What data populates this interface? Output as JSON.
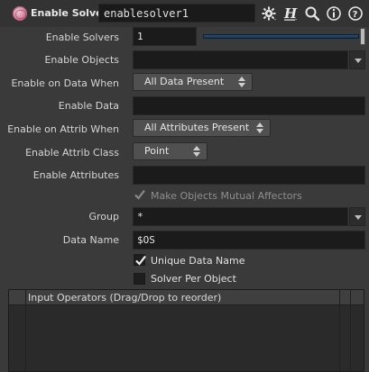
{
  "header": {
    "node_type": "Enable Solver",
    "node_name": "enablesolver1",
    "icons": [
      "brain-icon",
      "gear-icon",
      "help-h-icon",
      "search-icon",
      "info-icon",
      "help-icon"
    ]
  },
  "parameters": {
    "enable_solvers": {
      "label": "Enable Solvers",
      "value": "1",
      "slider_fraction": 1.0
    },
    "enable_objects": {
      "label": "Enable Objects",
      "value": ""
    },
    "enable_on_data_when": {
      "label": "Enable on Data When",
      "selected": "All Data Present"
    },
    "enable_data": {
      "label": "Enable Data",
      "value": ""
    },
    "enable_on_attrib_when": {
      "label": "Enable on Attrib When",
      "selected": "All Attributes Present"
    },
    "enable_attrib_class": {
      "label": "Enable Attrib Class",
      "selected": "Point"
    },
    "enable_attributes": {
      "label": "Enable Attributes",
      "value": ""
    },
    "make_objects_mutual_affectors": {
      "label": "Make Objects Mutual Affectors",
      "checked": true,
      "enabled": false
    },
    "group": {
      "label": "Group",
      "value": "*"
    },
    "data_name": {
      "label": "Data Name",
      "value": "$OS"
    },
    "unique_data_name": {
      "label": "Unique Data Name",
      "checked": true
    },
    "solver_per_object": {
      "label": "Solver Per Object",
      "checked": false
    }
  },
  "input_operators": {
    "header": "Input Operators (Drag/Drop to reorder)",
    "rows": []
  },
  "colors": {
    "background": "#3a3a3a",
    "field_bg": "#1b1b1b",
    "slider_accent": "#2a4f7c",
    "node_icon": "#d77f9c"
  }
}
